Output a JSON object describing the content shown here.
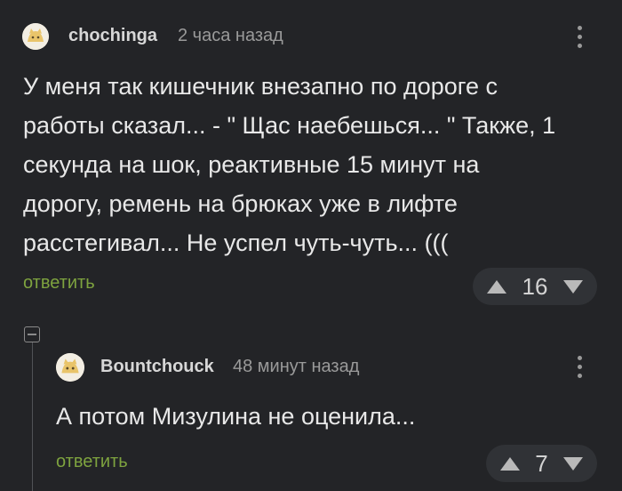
{
  "comments": [
    {
      "author": "chochinga",
      "time": "2 часа назад",
      "text": "У меня так кишечник внезапно по дороге с\nработы сказал... - \" Щас наебешься... \" Также, 1\nсекунда на шок, реактивные 15 минут на\nдорогу, ремень на брюках уже в лифте\nрасстегивал... Не успел чуть-чуть... (((",
      "reply_label": "ответить",
      "rating": "16"
    },
    {
      "author": "Bountchouck",
      "time": "48 минут назад",
      "text": "А потом Мизулина не оценила...",
      "reply_label": "ответить",
      "rating": "7"
    }
  ],
  "icons": {
    "avatar": "avatar-cat-icon",
    "menu": "more-vertical-icon",
    "upvote": "upvote-triangle-icon",
    "downvote": "downvote-triangle-icon",
    "collapse": "collapse-minus-icon"
  },
  "colors": {
    "background": "#232427",
    "reply_link": "#7ea33f",
    "text": "#e8e8e8",
    "muted": "#9a9a9a"
  }
}
